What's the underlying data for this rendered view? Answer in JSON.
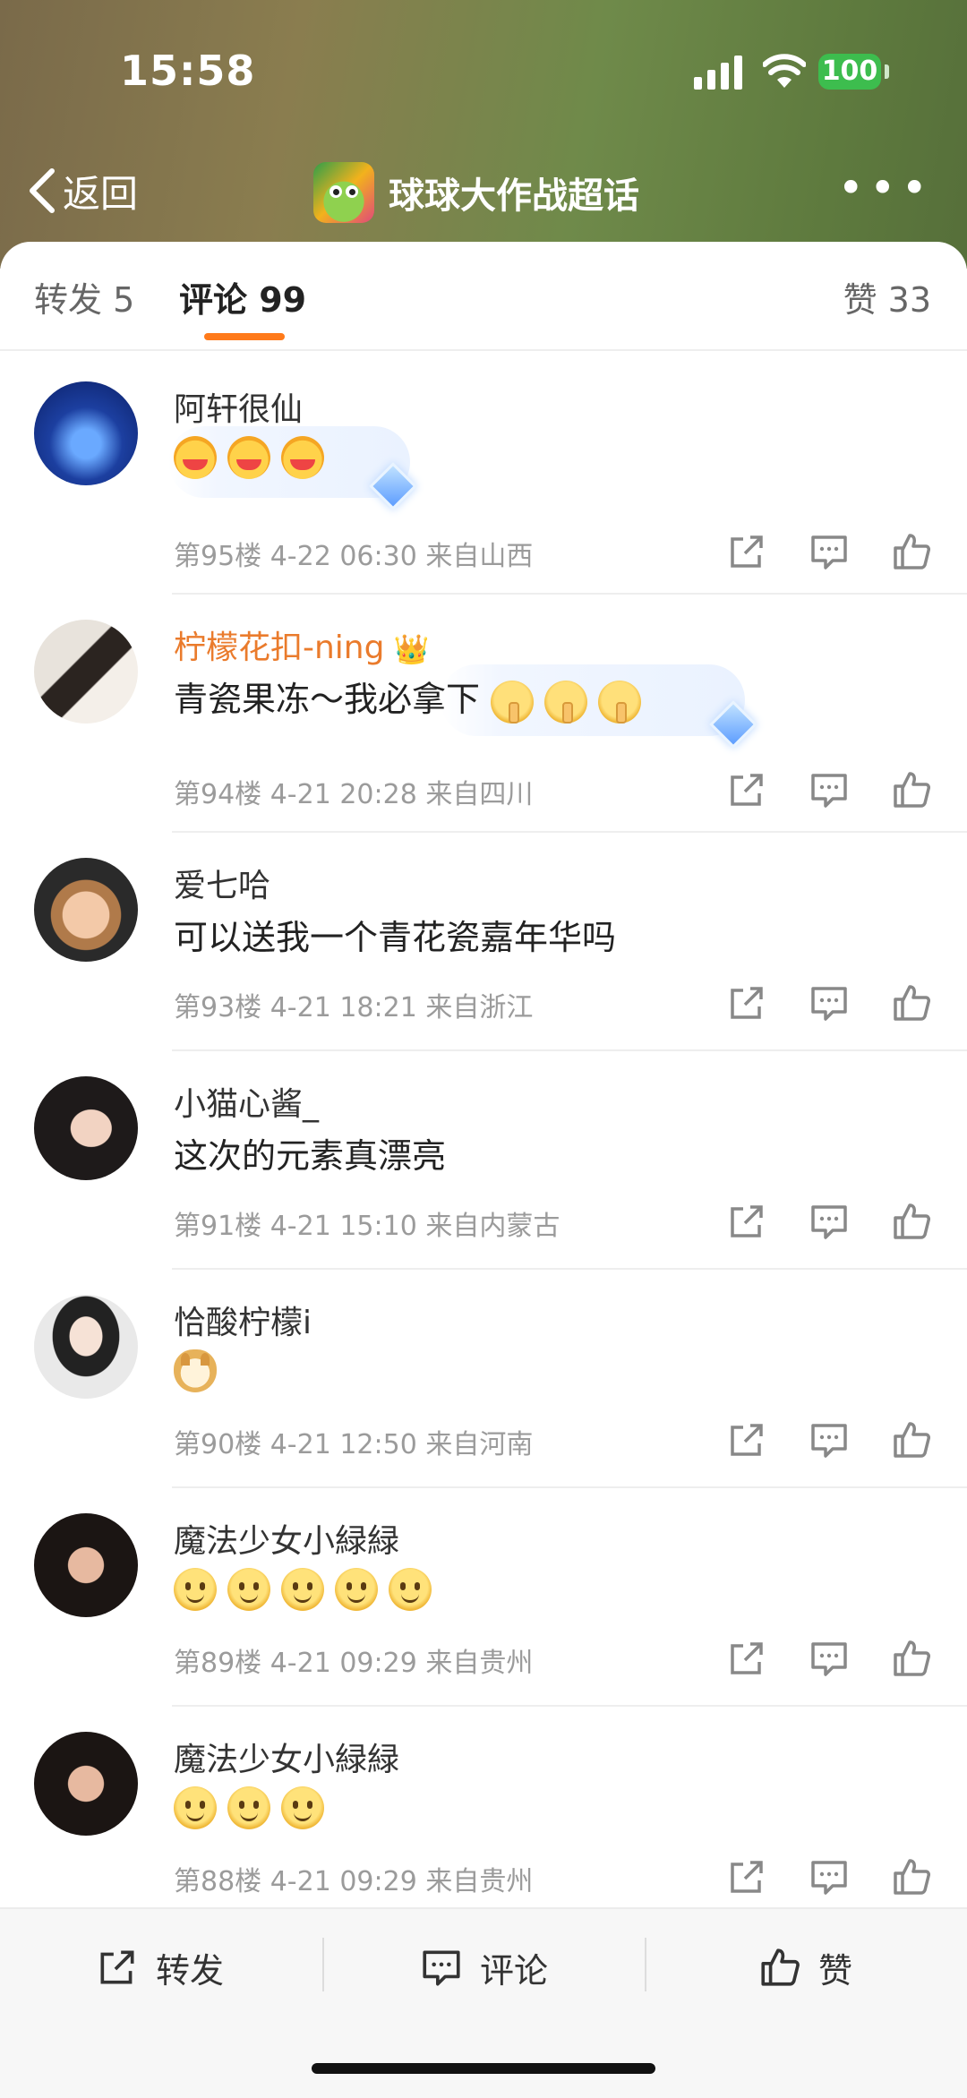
{
  "status_bar": {
    "time": "15:58",
    "battery": "100"
  },
  "nav": {
    "back_label": "返回",
    "title": "球球大作战超话"
  },
  "tabs": {
    "repost": "转发 5",
    "comment": "评论 99",
    "like": "赞 33"
  },
  "comments": [
    {
      "user": "阿轩很仙",
      "text": "",
      "emojis": [
        "cheer",
        "cheer",
        "cheer"
      ],
      "meta": "第95楼 4-22 06:30 来自山西"
    },
    {
      "user": "柠檬花扣-ning",
      "text": "青瓷果冻～我必拿下",
      "emojis": [
        "shh",
        "shh",
        "shh"
      ],
      "meta": "第94楼 4-21 20:28 来自四川"
    },
    {
      "user": "爱七哈",
      "text": "可以送我一个青花瓷嘉年华吗",
      "emojis": [],
      "meta": "第93楼 4-21 18:21 来自浙江"
    },
    {
      "user": "小猫心酱_",
      "text": "这次的元素真漂亮",
      "emojis": [],
      "meta": "第91楼 4-21 15:10 来自内蒙古"
    },
    {
      "user": "恰酸柠檬i",
      "text": "",
      "emojis": [
        "doge"
      ],
      "meta": "第90楼 4-21 12:50 来自河南"
    },
    {
      "user": "魔法少女小緑緑",
      "text": "",
      "emojis": [
        "smile",
        "smile",
        "smile",
        "smile",
        "smile"
      ],
      "meta": "第89楼 4-21 09:29 来自贵州"
    },
    {
      "user": "魔法少女小緑緑",
      "text": "",
      "emojis": [
        "smile",
        "smile",
        "smile"
      ],
      "meta": "第88楼 4-21 09:29 来自贵州"
    }
  ],
  "bottom_bar": {
    "repost": "转发",
    "comment": "评论",
    "like": "赞"
  },
  "colors": {
    "accent": "#ff7a1a",
    "vip_name": "#ea7b2c",
    "header_from": "#7a6a4a",
    "header_to": "#566f3a"
  },
  "icons": [
    "back-chevron-icon",
    "more-icon",
    "share-icon",
    "comment-icon",
    "like-icon",
    "crown-icon",
    "diamond-icon"
  ]
}
